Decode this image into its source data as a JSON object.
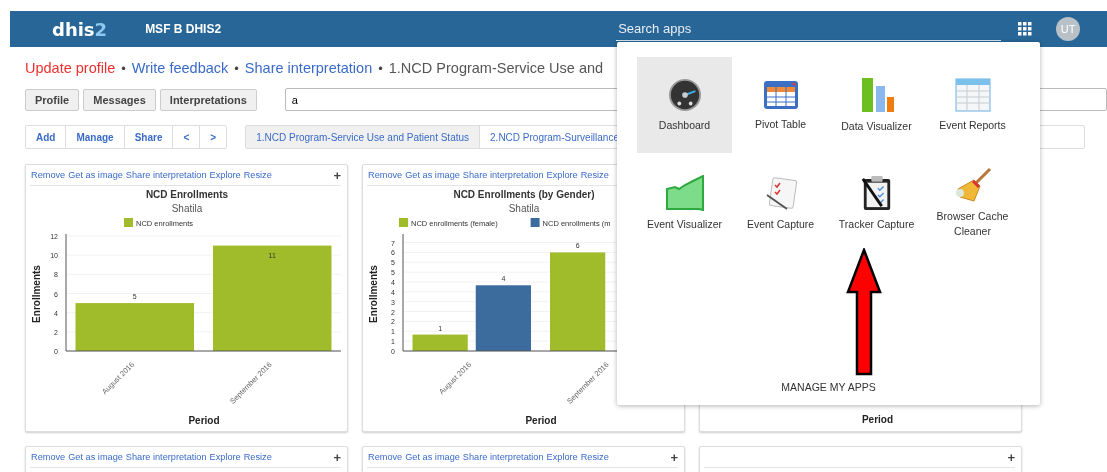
{
  "header": {
    "logo": "dhis",
    "logo_accent": "2",
    "instance": "MSF B DHIS2",
    "search": {
      "placeholder": "Search apps"
    },
    "avatar": "UT"
  },
  "breadcrumb": [
    {
      "kind": "alert",
      "text": "Update profile"
    },
    {
      "kind": "bullet",
      "text": "•"
    },
    {
      "kind": "link",
      "text": "Write feedback"
    },
    {
      "kind": "bullet",
      "text": "•"
    },
    {
      "kind": "link",
      "text": "Share interpretation"
    },
    {
      "kind": "bullet",
      "text": "•"
    },
    {
      "kind": "title",
      "text": "1.NCD Program-Service Use and"
    }
  ],
  "profile_buttons": [
    "Profile",
    "Messages",
    "Interpretations"
  ],
  "search_field": {
    "value": "a"
  },
  "toolbar": [
    "Add",
    "Manage",
    "Share",
    "<",
    ">"
  ],
  "dashboard_tabs": [
    {
      "label": "1.NCD Program-Service Use and Patient Status",
      "selected": true
    },
    {
      "label": "2.NCD Program-Surveillance",
      "selected": false
    }
  ],
  "cards": [
    {
      "kind": "chart",
      "actions": [
        "Remove",
        "Get as image",
        "Share interpretation",
        "Explore",
        "Resize"
      ],
      "expand": "+",
      "chart_data": {
        "type": "bar",
        "title": "NCD Enrollments",
        "subtitle": "Shatila",
        "xlabel": "Period",
        "ylabel": "Enrollments",
        "categories": [
          "August 2016",
          "September 2016"
        ],
        "legend": "top",
        "grid": true,
        "series": [
          {
            "name": "NCD enrollments",
            "color": "#a1bc2b",
            "values": [
              5,
              11
            ]
          }
        ],
        "ylim": [
          0,
          12
        ],
        "yticks": [
          0,
          2,
          4,
          6,
          8,
          10,
          12
        ],
        "data_labels": true
      }
    },
    {
      "kind": "chart",
      "actions": [
        "Remove",
        "Get as image",
        "Share interpretation",
        "Explore",
        "Resize"
      ],
      "chart_data": {
        "type": "bar",
        "title": "NCD Enrollments (by Gender)",
        "subtitle": "Shatila",
        "xlabel": "Period",
        "ylabel": "Enrollments",
        "categories": [
          "August 2016",
          "September 2016"
        ],
        "legend": "top",
        "grid": true,
        "series": [
          {
            "name": "NCD enrollments (female)",
            "color": "#a1bc2b",
            "values": [
              1,
              6
            ]
          },
          {
            "name": "NCD enrollments (m",
            "color": "#3c6c9e",
            "values": [
              4,
              null
            ]
          }
        ],
        "ylim": [
          0,
          7
        ],
        "yticks": [
          {
            "value": 0,
            "label": "0"
          },
          {
            "value": 0.6,
            "label": "1"
          },
          {
            "value": 1.2,
            "label": "1"
          },
          {
            "value": 1.8,
            "label": "2"
          },
          {
            "value": 2.4,
            "label": "2"
          },
          {
            "value": 3,
            "label": "3"
          },
          {
            "value": 3.6,
            "label": "4"
          },
          {
            "value": 4.2,
            "label": "4"
          },
          {
            "value": 4.8,
            "label": "5"
          },
          {
            "value": 5.4,
            "label": "5"
          },
          {
            "value": 6,
            "label": "6"
          },
          {
            "value": 6.6,
            "label": "7"
          }
        ],
        "data_labels": true
      }
    },
    {
      "kind": "covered",
      "xlabel": "Period"
    }
  ],
  "bottom_cards": [
    {
      "actions": [
        "Remove",
        "Get as image",
        "Share interpretation",
        "Explore",
        "Resize"
      ],
      "expand": "+"
    },
    {
      "actions": [
        "Remove",
        "Get as image",
        "Share interpretation",
        "Explore",
        "Resize"
      ],
      "expand": "+"
    },
    {
      "expand": "+"
    }
  ],
  "app_menu": {
    "apps": [
      {
        "kind": "dashboard",
        "label": "Dashboard",
        "selected": true
      },
      {
        "kind": "pivot",
        "label": "Pivot Table",
        "selected": false
      },
      {
        "kind": "visualizer",
        "label": "Data Visualizer",
        "selected": false
      },
      {
        "kind": "reports",
        "label": "Event Reports",
        "selected": false
      },
      {
        "kind": "event-visualizer",
        "label": "Event Visualizer",
        "selected": false
      },
      {
        "kind": "event-capture",
        "label": "Event Capture",
        "selected": false
      },
      {
        "kind": "tracker",
        "label": "Tracker Capture",
        "selected": false
      },
      {
        "kind": "broom",
        "label": "Browser Cache Cleaner",
        "selected": false
      }
    ],
    "footer": "MANAGE MY APPS"
  }
}
